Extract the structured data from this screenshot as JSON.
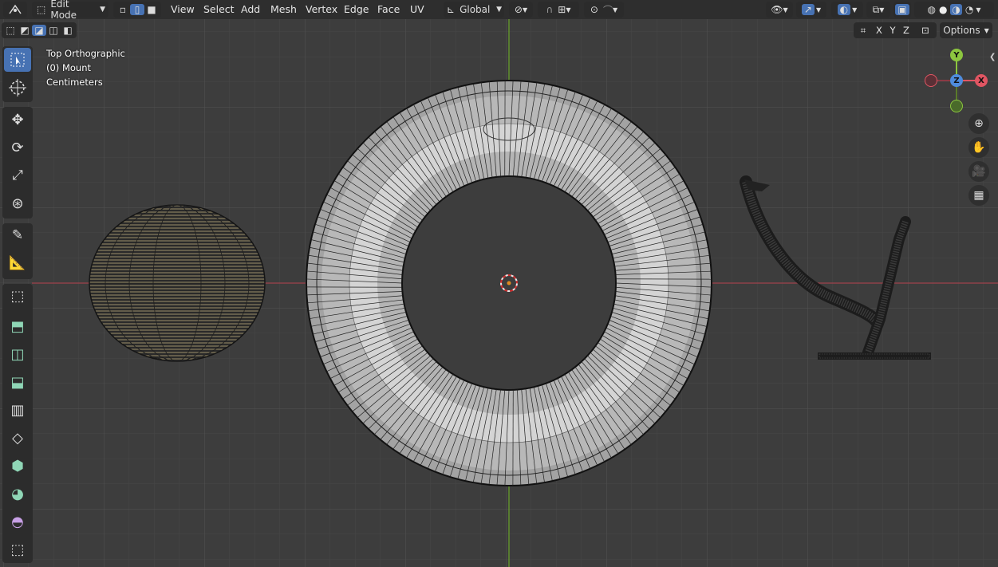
{
  "header": {
    "mode_label": "Edit Mode",
    "menus": [
      "View",
      "Select",
      "Add",
      "Mesh",
      "Vertex",
      "Edge",
      "Face",
      "UV"
    ],
    "transform_orientation": "Global"
  },
  "subheader": {
    "axis_x": "X",
    "axis_y": "Y",
    "axis_z": "Z",
    "options_label": "Options"
  },
  "viewport": {
    "view_name": "Top Orthographic",
    "object_name": "(0) Mount",
    "units": "Centimeters"
  },
  "gizmo": {
    "y_label": "Y",
    "z_label": "Z",
    "x_label": "X",
    "colors": {
      "x": "#e05562",
      "y": "#8cc63f",
      "z": "#4f8cdc"
    }
  },
  "colors": {
    "accent": "#4772b3",
    "x_axis_line": "#a0434c",
    "y_axis_line": "#6aa52a"
  },
  "toolbar_icons": [
    "select-box-icon",
    "cursor-icon",
    "move-icon",
    "rotate-icon",
    "scale-icon",
    "transform-icon",
    "annotate-icon",
    "measure-icon",
    "add-cube-icon",
    "extrude-icon",
    "inset-icon",
    "bevel-icon",
    "loop-cut-icon",
    "knife-icon",
    "poly-build-icon",
    "spin-icon",
    "smooth-icon",
    "shrink-fatten-icon"
  ]
}
